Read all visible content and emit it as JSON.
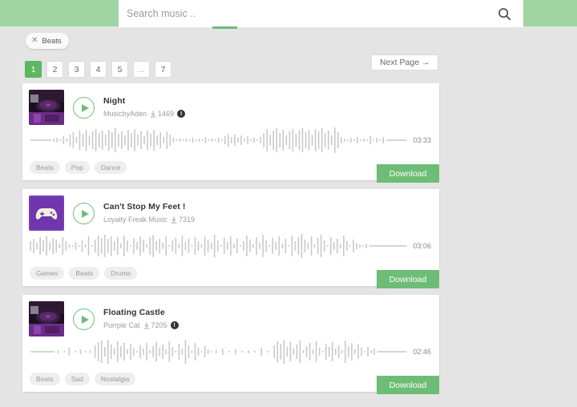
{
  "search": {
    "placeholder": "Search music ..",
    "value": "",
    "icon": "search-icon"
  },
  "filters": {
    "chips": [
      {
        "label": "Beats",
        "remove_icon": "close-icon"
      }
    ]
  },
  "pagination": {
    "pages": [
      "1",
      "2",
      "3",
      "4",
      "5",
      "…",
      "7"
    ],
    "active": "1",
    "next_label": "Next Page  →"
  },
  "colors": {
    "header_green": "#9ed5a2",
    "accent_green": "#6dbd77",
    "active_page_green": "#5cb860",
    "page_background": "#e4e4e4",
    "card_background": "#ffffff",
    "waveform_gray": "#c9c9c9"
  },
  "tracks": [
    {
      "title": "Night",
      "artist": "MusicbyAden",
      "downloads": "1469",
      "download_icon": "download-arrow-icon",
      "info_icon": "info-icon",
      "has_info": true,
      "duration": "03:33",
      "play_icon": "play-icon",
      "thumbnail": "turntable-purple",
      "tags": [
        "Beats",
        "Pop",
        "Dance"
      ],
      "download_label": "Download"
    },
    {
      "title": "Can't Stop My Feet !",
      "artist": "Loyalty Freak Music",
      "downloads": "7319",
      "download_icon": "download-arrow-icon",
      "info_icon": "",
      "has_info": false,
      "duration": "03:06",
      "play_icon": "play-icon",
      "thumbnail": "gamepad-purple",
      "tags": [
        "Games",
        "Beats",
        "Drums"
      ],
      "download_label": "Download"
    },
    {
      "title": "Floating Castle",
      "artist": "Purrple Cat",
      "downloads": "7205",
      "download_icon": "download-arrow-icon",
      "info_icon": "info-icon",
      "has_info": true,
      "duration": "02:46",
      "play_icon": "play-icon",
      "thumbnail": "turntable-purple",
      "tags": [
        "Beats",
        "Sad",
        "Nostalgia"
      ],
      "download_label": "Download"
    }
  ]
}
